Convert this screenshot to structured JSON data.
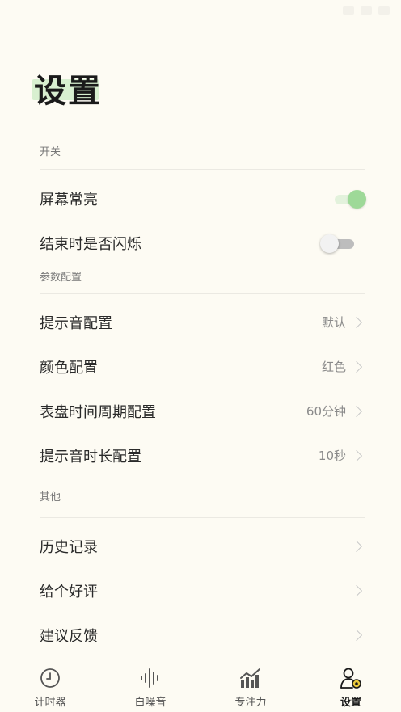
{
  "page": {
    "title": "设置"
  },
  "sections": {
    "switches": {
      "header": "开关",
      "screen_on": {
        "label": "屏幕常亮",
        "enabled": true
      },
      "flash_end": {
        "label": "结束时是否闪烁",
        "enabled": false
      }
    },
    "params": {
      "header": "参数配置",
      "sound": {
        "label": "提示音配置",
        "value": "默认"
      },
      "color": {
        "label": "颜色配置",
        "value": "红色"
      },
      "dial": {
        "label": "表盘时间周期配置",
        "value": "60分钟"
      },
      "duration": {
        "label": "提示音时长配置",
        "value": "10秒"
      }
    },
    "other": {
      "header": "其他",
      "history": {
        "label": "历史记录"
      },
      "rate": {
        "label": "给个好评"
      },
      "feedback": {
        "label": "建议反馈"
      }
    }
  },
  "tabs": {
    "timer": {
      "label": "计时器",
      "icon": "clock-icon"
    },
    "noise": {
      "label": "白噪音",
      "icon": "sound-wave-icon"
    },
    "focus": {
      "label": "专注力",
      "icon": "chart-icon"
    },
    "settings": {
      "label": "设置",
      "icon": "user-gear-icon",
      "active": true
    }
  },
  "colors": {
    "accent": "#9ed998",
    "background": "#fdfbf3",
    "highlight": "#d8efd0"
  }
}
